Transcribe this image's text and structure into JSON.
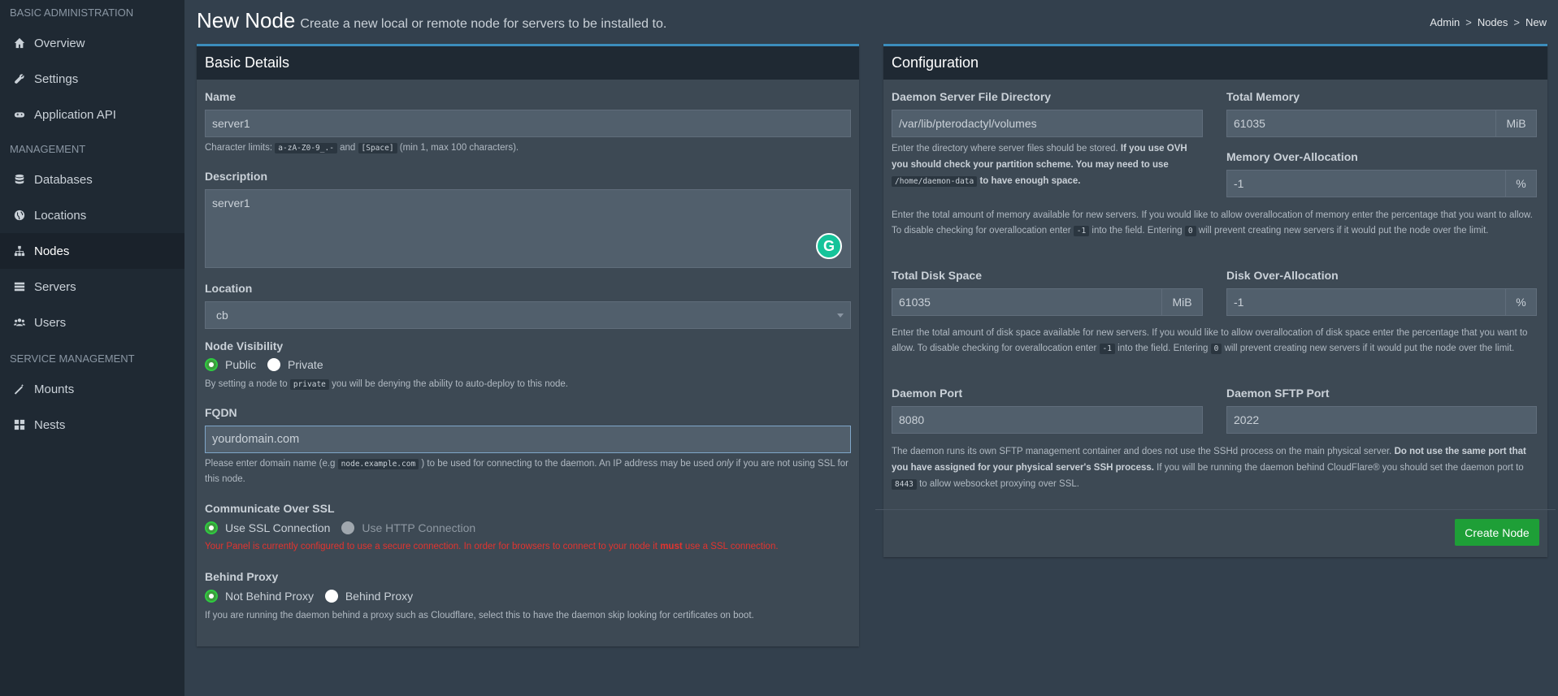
{
  "sidebar": {
    "sections": [
      {
        "header": "BASIC ADMINISTRATION",
        "items": [
          {
            "label": "Overview",
            "icon": "home-icon"
          },
          {
            "label": "Settings",
            "icon": "wrench-icon"
          },
          {
            "label": "Application API",
            "icon": "gamepad-icon"
          }
        ]
      },
      {
        "header": "MANAGEMENT",
        "items": [
          {
            "label": "Databases",
            "icon": "database-icon"
          },
          {
            "label": "Locations",
            "icon": "globe-icon"
          },
          {
            "label": "Nodes",
            "icon": "sitemap-icon",
            "active": true
          },
          {
            "label": "Servers",
            "icon": "server-icon"
          },
          {
            "label": "Users",
            "icon": "users-icon"
          }
        ]
      },
      {
        "header": "SERVICE MANAGEMENT",
        "items": [
          {
            "label": "Mounts",
            "icon": "magic-icon"
          },
          {
            "label": "Nests",
            "icon": "th-large-icon"
          }
        ]
      }
    ]
  },
  "header": {
    "title": "New Node",
    "subtitle": "Create a new local or remote node for servers to be installed to.",
    "breadcrumb": [
      "Admin",
      ">",
      "Nodes",
      ">",
      "New"
    ]
  },
  "basic": {
    "title": "Basic Details",
    "name_label": "Name",
    "name_value": "server1",
    "name_help_1": "Character limits:",
    "name_help_code1": "a-zA-Z0-9_.-",
    "name_help_2": "and",
    "name_help_code2": "[Space]",
    "name_help_3": "(min 1, max 100 characters).",
    "desc_label": "Description",
    "desc_value": "server1",
    "location_label": "Location",
    "location_value": "cb",
    "visibility_label": "Node Visibility",
    "visibility_public": "Public",
    "visibility_private": "Private",
    "visibility_help_1": "By setting a node to",
    "visibility_help_code": "private",
    "visibility_help_2": "you will be denying the ability to auto-deploy to this node.",
    "fqdn_label": "FQDN",
    "fqdn_value": "yourdomain.com",
    "fqdn_help_1": "Please enter domain name (e.g",
    "fqdn_help_code": "node.example.com",
    "fqdn_help_2": ") to be used for connecting to the daemon. An IP address may be used",
    "fqdn_help_em": "only",
    "fqdn_help_3": "if you are not using SSL for this node.",
    "ssl_label": "Communicate Over SSL",
    "ssl_on": "Use SSL Connection",
    "ssl_off": "Use HTTP Connection",
    "ssl_warning_1": "Your Panel is currently configured to use a secure connection. In order for browsers to connect to your node it",
    "ssl_warning_bold": "must",
    "ssl_warning_2": "use a SSL connection.",
    "proxy_label": "Behind Proxy",
    "proxy_no": "Not Behind Proxy",
    "proxy_yes": "Behind Proxy",
    "proxy_help": "If you are running the daemon behind a proxy such as Cloudflare, select this to have the daemon skip looking for certificates on boot."
  },
  "config": {
    "title": "Configuration",
    "dir_label": "Daemon Server File Directory",
    "dir_value": "/var/lib/pterodactyl/volumes",
    "dir_help_1": "Enter the directory where server files should be stored.",
    "dir_help_bold": "If you use OVH you should check your partition scheme. You may need to use",
    "dir_help_code": "/home/daemon-data",
    "dir_help_2": "to have enough space.",
    "mem_label": "Total Memory",
    "mem_value": "61035",
    "mem_unit": "MiB",
    "memover_label": "Memory Over-Allocation",
    "memover_value": "-1",
    "memover_unit": "%",
    "mem_help_1": "Enter the total amount of memory available for new servers. If you would like to allow overallocation of memory enter the percentage that you want to allow. To disable checking for overallocation enter",
    "mem_help_code1": "-1",
    "mem_help_2": "into the field. Entering",
    "mem_help_code2": "0",
    "mem_help_3": "will prevent creating new servers if it would put the node over the limit.",
    "disk_label": "Total Disk Space",
    "disk_value": "61035",
    "disk_unit": "MiB",
    "diskover_label": "Disk Over-Allocation",
    "diskover_value": "-1",
    "diskover_unit": "%",
    "disk_help_1": "Enter the total amount of disk space available for new servers. If you would like to allow overallocation of disk space enter the percentage that you want to allow. To disable checking for overallocation enter",
    "disk_help_code1": "-1",
    "disk_help_2": "into the field. Entering",
    "disk_help_code2": "0",
    "disk_help_3": "will prevent creating new servers if it would put the node over the limit.",
    "port_label": "Daemon Port",
    "port_value": "8080",
    "sftp_label": "Daemon SFTP Port",
    "sftp_value": "2022",
    "port_help_1": "The daemon runs its own SFTP management container and does not use the SSHd process on the main physical server.",
    "port_help_bold": "Do not use the same port that you have assigned for your physical server's SSH process.",
    "port_help_2": "If you will be running the daemon behind CloudFlare® you should set the daemon port to",
    "port_help_code": "8443",
    "port_help_3": "to allow websocket proxying over SSL.",
    "submit": "Create Node"
  },
  "colors": {
    "accent": "#3c8dbc",
    "success": "#1e9f37",
    "danger": "#e3342f"
  }
}
